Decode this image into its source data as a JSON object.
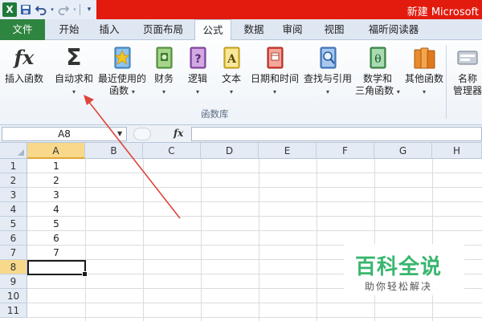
{
  "window": {
    "title": "新建 Microsoft"
  },
  "qat": {
    "excel_icon": "X",
    "save_icon": "save-icon",
    "undo_icon": "undo-icon",
    "redo_icon": "redo-icon",
    "customize_icon": "customize-qat-icon"
  },
  "tabs": [
    "文件",
    "开始",
    "插入",
    "页面布局",
    "公式",
    "数据",
    "审阅",
    "视图",
    "福昕阅读器"
  ],
  "active_tab": "公式",
  "ribbon": {
    "insert_function": {
      "glyph": "fx",
      "label": "插入函数"
    },
    "autosum": {
      "glyph": "Σ",
      "label": "自动求和",
      "caret": "▾"
    },
    "recent": {
      "line1": "最近使用的",
      "line2": "函数",
      "caret": "▾"
    },
    "financial": {
      "label": "财务",
      "caret": "▾"
    },
    "logical": {
      "glyph": "?",
      "label": "逻辑",
      "caret": "▾"
    },
    "text": {
      "glyph": "A",
      "label": "文本",
      "caret": "▾"
    },
    "datetime": {
      "label": "日期和时间",
      "caret": "▾"
    },
    "lookup": {
      "label": "查找与引用",
      "caret": "▾"
    },
    "math": {
      "glyph": "θ",
      "line1": "数学和",
      "line2": "三角函数",
      "caret": "▾"
    },
    "more": {
      "label": "其他函数",
      "caret": "▾"
    },
    "name_manager": {
      "line1": "名称",
      "line2": "管理器"
    },
    "group_label": "函数库"
  },
  "formula_bar": {
    "name_box": "A8",
    "fx": "fx",
    "content": ""
  },
  "sheet": {
    "columns": [
      "A",
      "B",
      "C",
      "D",
      "E",
      "F",
      "G",
      "H"
    ],
    "selected_column": "A",
    "rows": [
      "1",
      "2",
      "3",
      "4",
      "5",
      "6",
      "7",
      "8",
      "9",
      "10",
      "11"
    ],
    "selected_row": "8",
    "column_a_values": [
      "1",
      "2",
      "3",
      "4",
      "5",
      "6",
      "7"
    ],
    "active_cell": "A8"
  },
  "watermark": {
    "main": "百科全说",
    "sub": "助你轻松解决"
  },
  "colors": {
    "title_red": "#e31b0e",
    "file_tab": "#2e8540",
    "selection_header": "#f8d98b",
    "annotation_arrow": "#e0443a",
    "watermark_green": "#38b66e"
  }
}
